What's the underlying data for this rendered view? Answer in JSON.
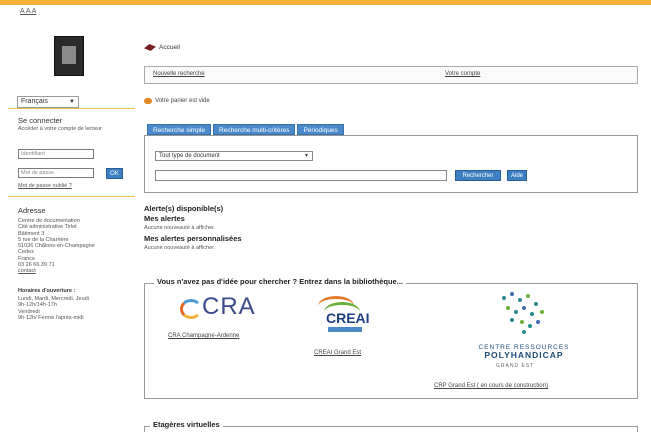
{
  "header": {
    "font_size_control": "A A A"
  },
  "sidebar": {
    "language": {
      "selected": "Français"
    },
    "login": {
      "title": "Se connecter",
      "description": "Accéder à votre compte de lecteur",
      "username_placeholder": "Identifiant",
      "password_placeholder": "Mot de passe",
      "ok_label": "OK",
      "forgot_link": "Mot de passe oublié ?"
    },
    "address": {
      "title": "Adresse",
      "lines": [
        "Centre de documentation",
        "Cité administrative Tirlet",
        "Bâtiment 3",
        "5 rue de la Charrière",
        "51036 Châlons-en-Champagne",
        "Cedex",
        "France",
        "03 26 66 39 71"
      ],
      "contact_link": "contact"
    },
    "hours": {
      "title": "Horaires d'ouverture :",
      "lines": [
        "Lundi, Mardi, Mercredi, Jeudi",
        "9h-12h/14h-17h",
        "Vendredi",
        "9h-12h/ Fermé l'après-midi"
      ]
    }
  },
  "main": {
    "breadcrumb": "Accueil",
    "nav": {
      "new_search": "Nouvelle recherche",
      "account": "Votre compte"
    },
    "basket": "Votre panier est vide",
    "tabs": [
      "Recherche simple",
      "Recherche multi-critères",
      "Périodiques"
    ],
    "search": {
      "doc_type": "Tout type de document",
      "search_button": "Rechercher",
      "help_button": "Aide"
    },
    "alerts": {
      "available_title": "Alerte(s) disponible(s)",
      "my_alerts_title": "Mes alertes",
      "my_alerts_text": "Aucune nouveauté à afficher.",
      "custom_title": "Mes alertes personnalisées",
      "custom_text": "Aucune nouveauté à afficher."
    },
    "libraries": {
      "legend": "Vous n'avez pas d'idée pour chercher ? Entrez dans la bibliothèque...",
      "cra": {
        "logo_text": "CRA",
        "caption": "CRA Champagne-Ardenne"
      },
      "creai": {
        "logo_text": "CREAI",
        "caption": "CREAI Grand Est"
      },
      "crp": {
        "logo_line1": "CENTRE RESSOURCES",
        "logo_line2": "POLYHANDICAP",
        "logo_line3": "GRAND EST",
        "caption": "CRP Grand Est ( en cours de construction)"
      }
    },
    "shelves": {
      "legend": "Etagères virtuelles"
    }
  },
  "colors": {
    "accent": "#f2b23a",
    "tab_blue": "#4a8acb",
    "button_blue": "#3d7fc1"
  }
}
